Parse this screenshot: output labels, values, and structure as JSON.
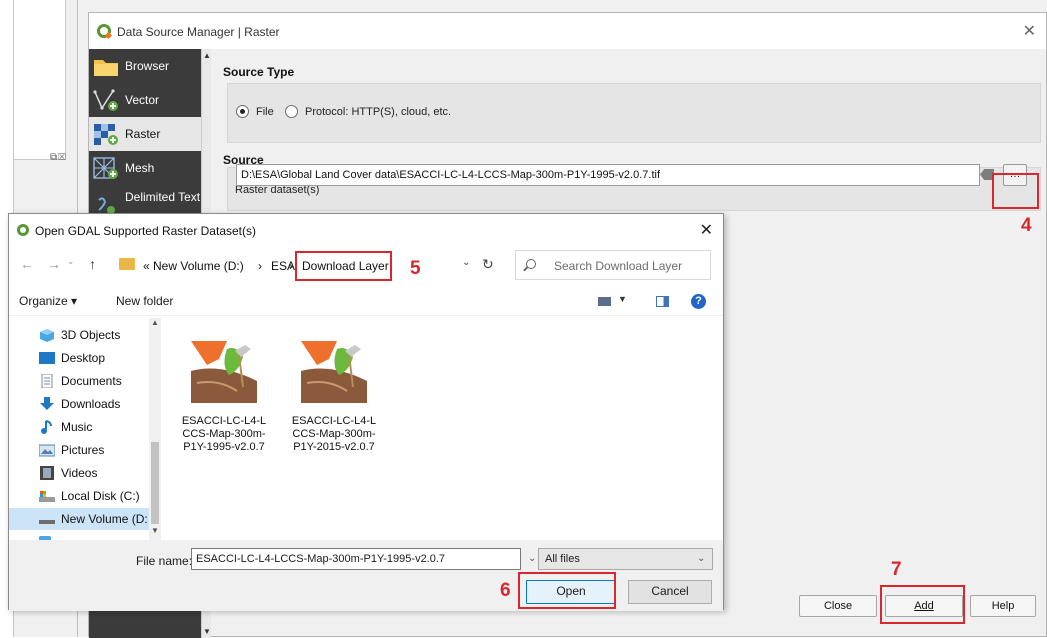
{
  "dsm": {
    "title": "Data Source Manager | Raster",
    "sidebar": [
      {
        "label": "Browser",
        "icon": "folder-icon"
      },
      {
        "label": "Vector",
        "icon": "vector-icon"
      },
      {
        "label": "Raster",
        "icon": "raster-icon"
      },
      {
        "label": "Mesh",
        "icon": "mesh-icon"
      },
      {
        "label": "Delimited Text",
        "icon": "delimited-text-icon"
      }
    ],
    "source_type": {
      "title": "Source Type",
      "option_file": "File",
      "option_protocol": "Protocol: HTTP(S), cloud, etc."
    },
    "source": {
      "title": "Source",
      "raster_label": "Raster dataset(s)",
      "raster_value": "D:\\ESA\\Global Land  Cover data\\ESACCI-LC-L4-LCCS-Map-300m-P1Y-1995-v2.0.7.tif",
      "browse_label": "…"
    },
    "buttons": {
      "close": "Close",
      "add": "Add",
      "help": "Help"
    }
  },
  "file_dialog": {
    "title": "Open GDAL Supported Raster Dataset(s)",
    "breadcrumb": [
      "« New Volume (D:)",
      "›",
      "ESA",
      "›",
      "Download Layer"
    ],
    "search_placeholder": "Search Download Layer",
    "toolbar": {
      "organize": "Organize ▾",
      "new_folder": "New folder"
    },
    "nav_items": [
      {
        "label": "3D Objects",
        "icon": "3d-objects-icon"
      },
      {
        "label": "Desktop",
        "icon": "desktop-icon"
      },
      {
        "label": "Documents",
        "icon": "documents-icon"
      },
      {
        "label": "Downloads",
        "icon": "downloads-icon"
      },
      {
        "label": "Music",
        "icon": "music-icon"
      },
      {
        "label": "Pictures",
        "icon": "pictures-icon"
      },
      {
        "label": "Videos",
        "icon": "videos-icon"
      },
      {
        "label": "Local Disk (C:)",
        "icon": "local-disk-icon"
      },
      {
        "label": "New Volume (D:",
        "icon": "drive-icon"
      }
    ],
    "files": [
      {
        "name": "ESACCI-LC-L4-LCCS-Map-300m-P1Y-1995-v2.0.7",
        "lines": [
          "ESACCI-LC-L4-L",
          "CCS-Map-300m-",
          "P1Y-1995-v2.0.7"
        ]
      },
      {
        "name": "ESACCI-LC-L4-LCCS-Map-300m-P1Y-2015-v2.0.7",
        "lines": [
          "ESACCI-LC-L4-L",
          "CCS-Map-300m-",
          "P1Y-2015-v2.0.7"
        ]
      }
    ],
    "file_name_label": "File name:",
    "file_name_value": "ESACCI-LC-L4-LCCS-Map-300m-P1Y-1995-v2.0.7",
    "filter_value": "All files",
    "open": "Open",
    "cancel": "Cancel"
  },
  "annotations": {
    "step4": "4",
    "step5": "5",
    "step6": "6",
    "step7": "7"
  },
  "colors": {
    "annotation": "#d9272e",
    "qgis_green": "#589632",
    "sidebar_dark": "#3b3b3b"
  }
}
